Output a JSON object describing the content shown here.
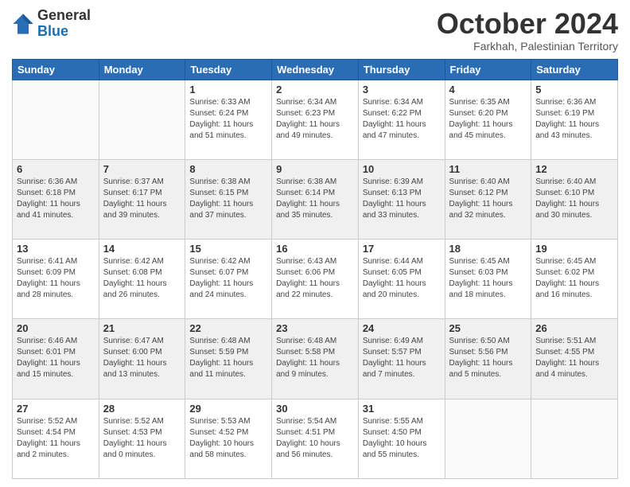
{
  "header": {
    "logo_general": "General",
    "logo_blue": "Blue",
    "month_title": "October 2024",
    "location": "Farkhah, Palestinian Territory"
  },
  "days_of_week": [
    "Sunday",
    "Monday",
    "Tuesday",
    "Wednesday",
    "Thursday",
    "Friday",
    "Saturday"
  ],
  "weeks": [
    [
      {
        "day": "",
        "sunrise": "",
        "sunset": "",
        "daylight": "",
        "empty": true
      },
      {
        "day": "",
        "sunrise": "",
        "sunset": "",
        "daylight": "",
        "empty": true
      },
      {
        "day": "1",
        "sunrise": "Sunrise: 6:33 AM",
        "sunset": "Sunset: 6:24 PM",
        "daylight": "Daylight: 11 hours and 51 minutes."
      },
      {
        "day": "2",
        "sunrise": "Sunrise: 6:34 AM",
        "sunset": "Sunset: 6:23 PM",
        "daylight": "Daylight: 11 hours and 49 minutes."
      },
      {
        "day": "3",
        "sunrise": "Sunrise: 6:34 AM",
        "sunset": "Sunset: 6:22 PM",
        "daylight": "Daylight: 11 hours and 47 minutes."
      },
      {
        "day": "4",
        "sunrise": "Sunrise: 6:35 AM",
        "sunset": "Sunset: 6:20 PM",
        "daylight": "Daylight: 11 hours and 45 minutes."
      },
      {
        "day": "5",
        "sunrise": "Sunrise: 6:36 AM",
        "sunset": "Sunset: 6:19 PM",
        "daylight": "Daylight: 11 hours and 43 minutes."
      }
    ],
    [
      {
        "day": "6",
        "sunrise": "Sunrise: 6:36 AM",
        "sunset": "Sunset: 6:18 PM",
        "daylight": "Daylight: 11 hours and 41 minutes."
      },
      {
        "day": "7",
        "sunrise": "Sunrise: 6:37 AM",
        "sunset": "Sunset: 6:17 PM",
        "daylight": "Daylight: 11 hours and 39 minutes."
      },
      {
        "day": "8",
        "sunrise": "Sunrise: 6:38 AM",
        "sunset": "Sunset: 6:15 PM",
        "daylight": "Daylight: 11 hours and 37 minutes."
      },
      {
        "day": "9",
        "sunrise": "Sunrise: 6:38 AM",
        "sunset": "Sunset: 6:14 PM",
        "daylight": "Daylight: 11 hours and 35 minutes."
      },
      {
        "day": "10",
        "sunrise": "Sunrise: 6:39 AM",
        "sunset": "Sunset: 6:13 PM",
        "daylight": "Daylight: 11 hours and 33 minutes."
      },
      {
        "day": "11",
        "sunrise": "Sunrise: 6:40 AM",
        "sunset": "Sunset: 6:12 PM",
        "daylight": "Daylight: 11 hours and 32 minutes."
      },
      {
        "day": "12",
        "sunrise": "Sunrise: 6:40 AM",
        "sunset": "Sunset: 6:10 PM",
        "daylight": "Daylight: 11 hours and 30 minutes."
      }
    ],
    [
      {
        "day": "13",
        "sunrise": "Sunrise: 6:41 AM",
        "sunset": "Sunset: 6:09 PM",
        "daylight": "Daylight: 11 hours and 28 minutes."
      },
      {
        "day": "14",
        "sunrise": "Sunrise: 6:42 AM",
        "sunset": "Sunset: 6:08 PM",
        "daylight": "Daylight: 11 hours and 26 minutes."
      },
      {
        "day": "15",
        "sunrise": "Sunrise: 6:42 AM",
        "sunset": "Sunset: 6:07 PM",
        "daylight": "Daylight: 11 hours and 24 minutes."
      },
      {
        "day": "16",
        "sunrise": "Sunrise: 6:43 AM",
        "sunset": "Sunset: 6:06 PM",
        "daylight": "Daylight: 11 hours and 22 minutes."
      },
      {
        "day": "17",
        "sunrise": "Sunrise: 6:44 AM",
        "sunset": "Sunset: 6:05 PM",
        "daylight": "Daylight: 11 hours and 20 minutes."
      },
      {
        "day": "18",
        "sunrise": "Sunrise: 6:45 AM",
        "sunset": "Sunset: 6:03 PM",
        "daylight": "Daylight: 11 hours and 18 minutes."
      },
      {
        "day": "19",
        "sunrise": "Sunrise: 6:45 AM",
        "sunset": "Sunset: 6:02 PM",
        "daylight": "Daylight: 11 hours and 16 minutes."
      }
    ],
    [
      {
        "day": "20",
        "sunrise": "Sunrise: 6:46 AM",
        "sunset": "Sunset: 6:01 PM",
        "daylight": "Daylight: 11 hours and 15 minutes."
      },
      {
        "day": "21",
        "sunrise": "Sunrise: 6:47 AM",
        "sunset": "Sunset: 6:00 PM",
        "daylight": "Daylight: 11 hours and 13 minutes."
      },
      {
        "day": "22",
        "sunrise": "Sunrise: 6:48 AM",
        "sunset": "Sunset: 5:59 PM",
        "daylight": "Daylight: 11 hours and 11 minutes."
      },
      {
        "day": "23",
        "sunrise": "Sunrise: 6:48 AM",
        "sunset": "Sunset: 5:58 PM",
        "daylight": "Daylight: 11 hours and 9 minutes."
      },
      {
        "day": "24",
        "sunrise": "Sunrise: 6:49 AM",
        "sunset": "Sunset: 5:57 PM",
        "daylight": "Daylight: 11 hours and 7 minutes."
      },
      {
        "day": "25",
        "sunrise": "Sunrise: 6:50 AM",
        "sunset": "Sunset: 5:56 PM",
        "daylight": "Daylight: 11 hours and 5 minutes."
      },
      {
        "day": "26",
        "sunrise": "Sunrise: 5:51 AM",
        "sunset": "Sunset: 4:55 PM",
        "daylight": "Daylight: 11 hours and 4 minutes."
      }
    ],
    [
      {
        "day": "27",
        "sunrise": "Sunrise: 5:52 AM",
        "sunset": "Sunset: 4:54 PM",
        "daylight": "Daylight: 11 hours and 2 minutes."
      },
      {
        "day": "28",
        "sunrise": "Sunrise: 5:52 AM",
        "sunset": "Sunset: 4:53 PM",
        "daylight": "Daylight: 11 hours and 0 minutes."
      },
      {
        "day": "29",
        "sunrise": "Sunrise: 5:53 AM",
        "sunset": "Sunset: 4:52 PM",
        "daylight": "Daylight: 10 hours and 58 minutes."
      },
      {
        "day": "30",
        "sunrise": "Sunrise: 5:54 AM",
        "sunset": "Sunset: 4:51 PM",
        "daylight": "Daylight: 10 hours and 56 minutes."
      },
      {
        "day": "31",
        "sunrise": "Sunrise: 5:55 AM",
        "sunset": "Sunset: 4:50 PM",
        "daylight": "Daylight: 10 hours and 55 minutes."
      },
      {
        "day": "",
        "sunrise": "",
        "sunset": "",
        "daylight": "",
        "empty": true
      },
      {
        "day": "",
        "sunrise": "",
        "sunset": "",
        "daylight": "",
        "empty": true
      }
    ]
  ]
}
